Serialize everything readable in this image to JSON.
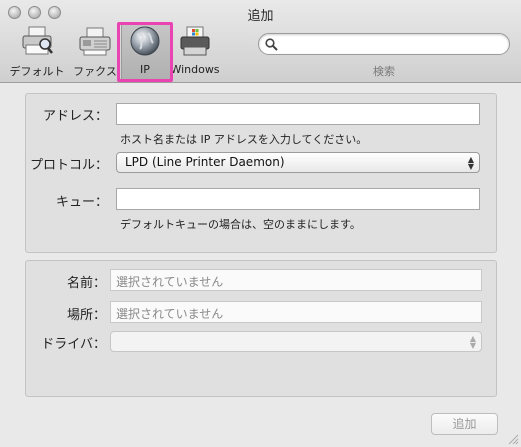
{
  "window": {
    "title": "追加"
  },
  "toolbar": {
    "items": [
      {
        "label": "デフォルト",
        "icon": "printer-magnifier-icon"
      },
      {
        "label": "ファクス",
        "icon": "fax-icon"
      },
      {
        "label": "IP",
        "icon": "globe-icon",
        "selected": true
      },
      {
        "label": "Windows",
        "icon": "windows-printer-icon"
      }
    ],
    "search_label": "検索",
    "search_placeholder": ""
  },
  "form1": {
    "address_label": "アドレス：",
    "address_value": "",
    "address_hint": "ホスト名または IP アドレスを入力してください。",
    "protocol_label": "プロトコル：",
    "protocol_value": "LPD (Line Printer Daemon)",
    "queue_label": "キュー：",
    "queue_value": "",
    "queue_hint": "デフォルトキューの場合は、空のままにします。"
  },
  "form2": {
    "name_label": "名前：",
    "name_placeholder": "選択されていません",
    "location_label": "場所：",
    "location_placeholder": "選択されていません",
    "driver_label": "ドライバ：",
    "driver_value": ""
  },
  "footer": {
    "add_button": "追加"
  },
  "colors": {
    "highlight": "#ea44b2",
    "window_bg": "#e9e9e9"
  }
}
